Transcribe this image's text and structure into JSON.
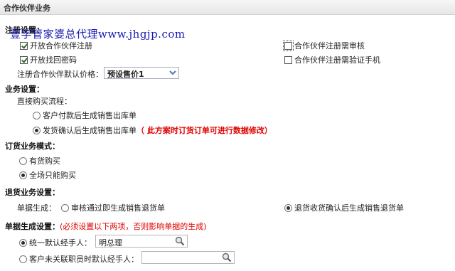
{
  "title": "合作伙伴业务",
  "watermark": "壹学管家婆总代理www.jhgjp.com",
  "registration": {
    "heading": "注册设置：",
    "open_partner_registration": {
      "label": "开放合作伙伴注册",
      "checked": true
    },
    "open_password_recovery": {
      "label": "开放找回密码",
      "checked": true
    },
    "require_review": {
      "label": "合作伙伴注册需审核",
      "checked": false
    },
    "require_phone_verification": {
      "label": "合作伙伴注册需验证手机",
      "checked": false
    },
    "default_price_label": "注册合作伙伴默认价格：",
    "default_price_value": "预设售价1"
  },
  "business": {
    "heading": "业务设置：",
    "direct_flow_label": "直接购买流程：",
    "options": [
      {
        "label": "客户付款后生成销售出库单",
        "checked": false
      },
      {
        "label": "发货确认后生成销售出库单",
        "checked": true
      }
    ],
    "note": "（ 此方案时订货订单可进行数据修改）"
  },
  "order_mode": {
    "heading": "订货业务模式：",
    "options": [
      {
        "label": "有货购买",
        "checked": false
      },
      {
        "label": "全场只能购买",
        "checked": true
      }
    ]
  },
  "returns": {
    "heading": "退货业务设置：",
    "doc_label": "单据生成：",
    "options": [
      {
        "label": "审核通过即生成销售退货单",
        "checked": false
      },
      {
        "label": "退货收货确认后生成销售退货单",
        "checked": true
      }
    ]
  },
  "doc_generation": {
    "heading": "单据生成设置：",
    "note": "(必须设置以下两项，否则影响单据的生成)",
    "unified_handler": {
      "label": "统一默认经手人：",
      "checked": true,
      "value": "明总理"
    },
    "unassociated_handler": {
      "label": "客户未关联职员时默认经手人：",
      "checked": false,
      "value": ""
    }
  },
  "colors": {
    "note_red": "#e00000",
    "watermark_blue": "#1a1ab0"
  }
}
